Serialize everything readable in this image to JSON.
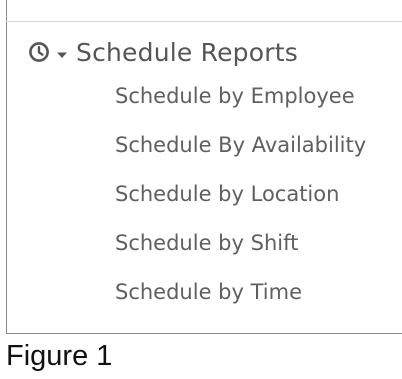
{
  "menu": {
    "icon": "clock-icon",
    "expand_icon": "caret-down-icon",
    "title": "Schedule Reports",
    "items": [
      {
        "label": "Schedule by Employee"
      },
      {
        "label": "Schedule By Availability"
      },
      {
        "label": "Schedule by Location"
      },
      {
        "label": "Schedule by Shift"
      },
      {
        "label": "Schedule by Time"
      }
    ]
  },
  "caption": "Figure 1",
  "colors": {
    "text": "#5f5f5f",
    "title": "#555555",
    "border": "#8a8a8a"
  }
}
